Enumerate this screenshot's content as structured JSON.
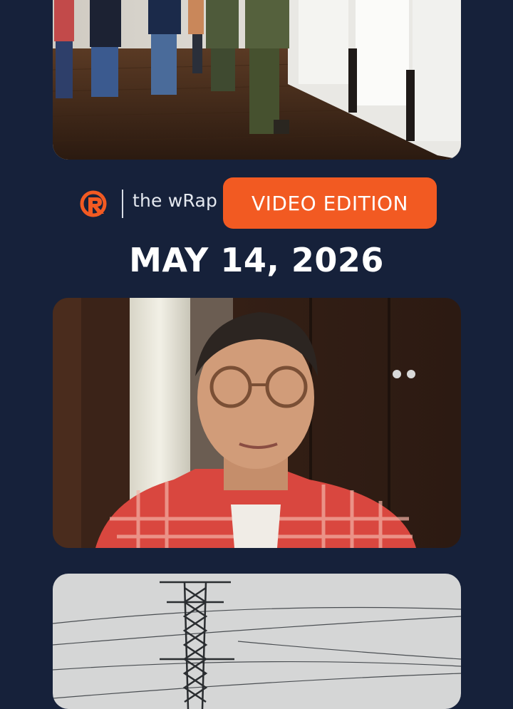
{
  "brand": {
    "logo_icon": "rappler-logo-icon",
    "name": "the wRap",
    "badge": "VIDEO EDITION",
    "badge_color": "#f25a22"
  },
  "edition_date": "MAY 14, 2026",
  "colors": {
    "background": "#16213a",
    "accent": "#f25a22"
  },
  "thumbnails": [
    {
      "subject": "soldiers-walking-thumbnail"
    },
    {
      "subject": "speaker-video-thumbnail"
    },
    {
      "subject": "power-transmission-tower-thumbnail"
    }
  ]
}
